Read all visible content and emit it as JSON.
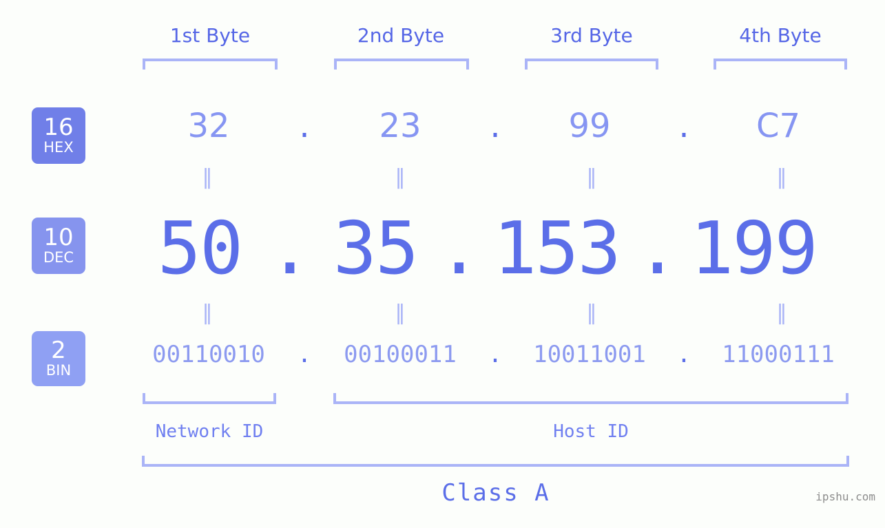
{
  "page": {
    "background_color": "#fcfefb",
    "accent_color": "#5b6ee8",
    "light_accent_color": "#8c9af0",
    "bracket_color": "#aab4f7"
  },
  "byte_headers": [
    {
      "label": "1st Byte"
    },
    {
      "label": "2nd Byte"
    },
    {
      "label": "3rd Byte"
    },
    {
      "label": "4th Byte"
    }
  ],
  "bases": [
    {
      "number": "16",
      "name": "HEX",
      "color": "#707fe8"
    },
    {
      "number": "10",
      "name": "DEC",
      "color": "#8694ee"
    },
    {
      "number": "2",
      "name": "BIN",
      "color": "#8fa0f3"
    }
  ],
  "rows": {
    "hex": {
      "base_number": "16",
      "base_name": "HEX",
      "octets": [
        "32",
        "23",
        "99",
        "C7"
      ],
      "separator": ".",
      "value": "32.23.99.C7"
    },
    "dec": {
      "base_number": "10",
      "base_name": "DEC",
      "octets": [
        "50",
        "35",
        "153",
        "199"
      ],
      "separator": ".",
      "value": "50.35.153.199"
    },
    "bin": {
      "base_number": "2",
      "base_name": "BIN",
      "octets": [
        "00110010",
        "00100011",
        "10011001",
        "11000111"
      ],
      "separator": ".",
      "value": "00110010.00100011.10011001.11000111"
    }
  },
  "equality_marks": {
    "glyph": "‖",
    "count_per_row": 4
  },
  "segments": {
    "network_id": {
      "label": "Network ID"
    },
    "host_id": {
      "label": "Host ID"
    },
    "class": {
      "label": "Class A"
    }
  },
  "watermark": {
    "text": "ipshu.com"
  }
}
